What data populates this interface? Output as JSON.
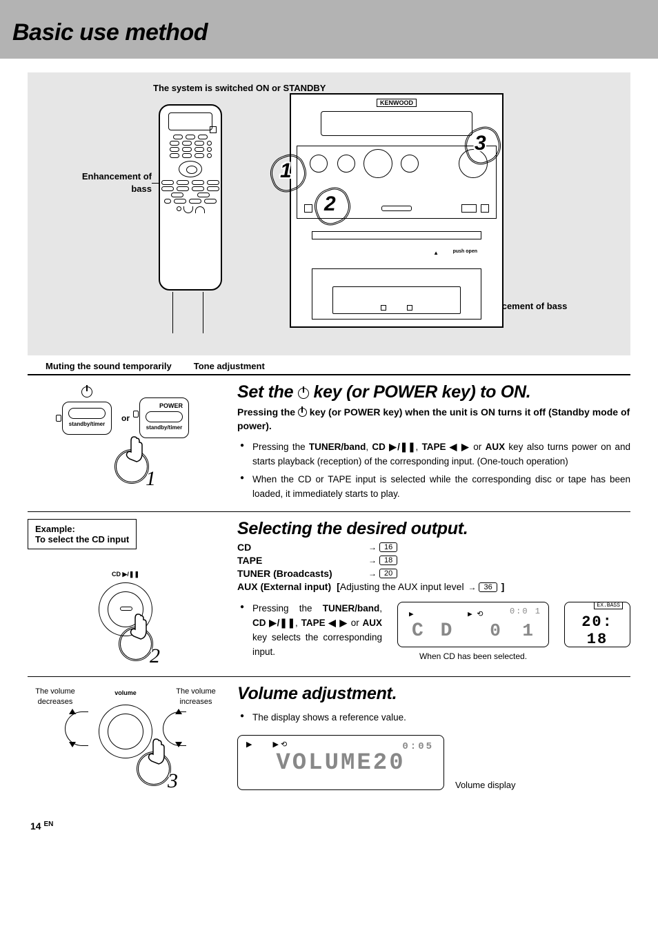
{
  "header": {
    "title": "Basic use method"
  },
  "diagram": {
    "callout_power": "The system is switched ON or STANDBY",
    "callout_bass_left": "Enhancement of bass",
    "callout_bass_right": "Enhancement of bass",
    "below_mute": "Muting the sound temporarily",
    "below_tone": "Tone adjustment",
    "brand": "KENWOOD",
    "push_open": "push open",
    "badge1": "1",
    "badge2": "2",
    "badge3": "3"
  },
  "step1": {
    "title_pre": "Set  the ",
    "title_post": " key (or POWER key) to ON.",
    "subtitle_pre": "Pressing the ",
    "subtitle_post": " key (or POWER key) when the unit is ON turns it off (Standby mode of power).",
    "bullets": [
      {
        "pre": "Pressing the ",
        "b1": "TUNER/band",
        "mid1": ", ",
        "b2": "CD ▶/❚❚",
        "mid2": ", ",
        "b3": "TAPE ◀ ▶",
        "mid3": " or ",
        "b4": "AUX",
        "post": " key also turns power on and starts playback (reception) of the corresponding input. (One-touch operation)"
      },
      {
        "pre": "When the CD or TAPE input is selected while the corresponding disc or tape has been loaded, it immediately starts to play."
      }
    ],
    "keys": {
      "power_label": "POWER",
      "standby_label": "standby/timer",
      "or": "or",
      "badge": "1"
    }
  },
  "step2": {
    "title": "Selecting the desired output.",
    "example_line1": "Example:",
    "example_line2": "To select the CD input",
    "cd_label": "CD ▶/❚❚",
    "rows": [
      {
        "label": "CD",
        "page": "16"
      },
      {
        "label": "TAPE",
        "page": "18"
      },
      {
        "label": "TUNER (Broadcasts)",
        "page": "20"
      }
    ],
    "aux_label": "AUX (External input)",
    "aux_bracket_pre": "[",
    "aux_bracket_text": "Adjusting the AUX input level",
    "aux_page": "36",
    "aux_bracket_post": "]",
    "input_bullet_pre": "Pressing the ",
    "input_bullet_b1": "TUNER/band",
    "input_bullet_m1": ", ",
    "input_bullet_b2": "CD ▶/❚❚",
    "input_bullet_m2": ", ",
    "input_bullet_b3": "TAPE ◀ ▶",
    "input_bullet_m3": " or ",
    "input_bullet_b4": "AUX",
    "input_bullet_post": " key selects the corresponding input.",
    "lcd": {
      "play_sym": "▶",
      "repeat_sym": "▶ ⟲",
      "timer": "0:0 1",
      "main": "C D",
      "track": "0 1",
      "caption": "When CD has been selected.",
      "exbass": "EX.BASS",
      "clock": "20: 18"
    },
    "badge": "2"
  },
  "step3": {
    "title": "Volume adjustment.",
    "bullet": "The display shows a reference value.",
    "dec": "The volume decreases",
    "inc": "The volume increases",
    "knob_label": "volume",
    "lcd": {
      "play_sym": "▶",
      "repeat_sym": "▶ ⟲",
      "timer": "0:05",
      "text": "VOLUME20",
      "caption": "Volume display"
    },
    "badge": "3"
  },
  "footer": {
    "page": "14",
    "lang": "EN"
  }
}
